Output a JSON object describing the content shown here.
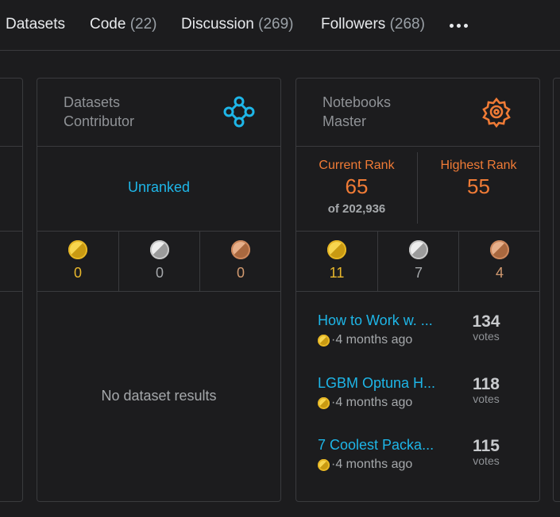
{
  "tabs": [
    {
      "label": "Datasets",
      "count": ""
    },
    {
      "label": "Code",
      "count": "(22)"
    },
    {
      "label": "Discussion",
      "count": "(269)"
    },
    {
      "label": "Followers",
      "count": "(268)"
    }
  ],
  "datasets_card": {
    "title_line1": "Datasets",
    "title_line2": "Contributor",
    "icon": "network-nodes-icon",
    "icon_color": "#1eb6e8",
    "rank_text": "Unranked",
    "medals": {
      "gold": "0",
      "silver": "0",
      "bronze": "0"
    },
    "empty_text": "No dataset results"
  },
  "notebooks_card": {
    "title_line1": "Notebooks",
    "title_line2": "Master",
    "icon": "gear-nodes-icon",
    "icon_color": "#f07b36",
    "current_rank_label": "Current Rank",
    "current_rank": "65",
    "current_rank_of": "of 202,936",
    "highest_rank_label": "Highest Rank",
    "highest_rank": "55",
    "medals": {
      "gold": "11",
      "silver": "7",
      "bronze": "4"
    },
    "items": [
      {
        "title": "How to Work w. ...",
        "meta": "·4 months ago",
        "votes": "134",
        "votes_label": "votes"
      },
      {
        "title": "LGBM Optuna H...",
        "meta": "·4 months ago",
        "votes": "118",
        "votes_label": "votes"
      },
      {
        "title": "7 Coolest Packa...",
        "meta": "·4 months ago",
        "votes": "115",
        "votes_label": "votes"
      }
    ]
  }
}
